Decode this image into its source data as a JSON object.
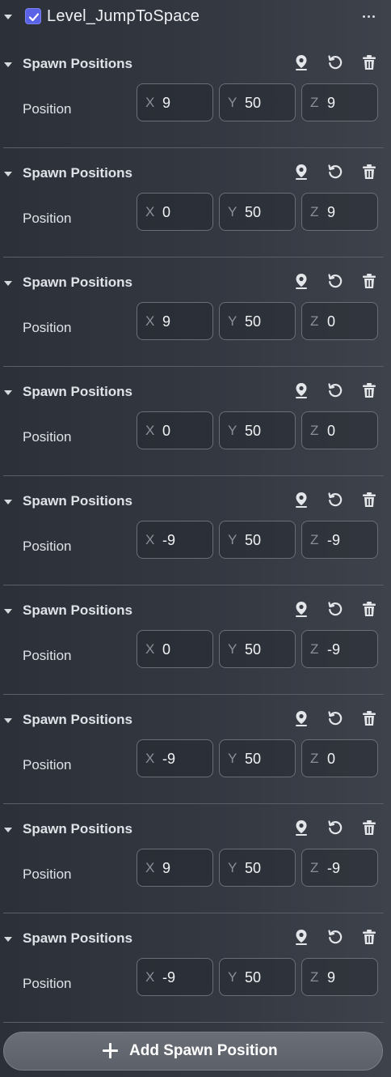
{
  "component": {
    "enabled": true,
    "title": "Level_JumpToSpace",
    "menu_icon": "more-horizontal-icon"
  },
  "spawn_positions": [
    {
      "title": "Spawn Positions",
      "label": "Position",
      "x": "9",
      "y": "50",
      "z": "9"
    },
    {
      "title": "Spawn Positions",
      "label": "Position",
      "x": "0",
      "y": "50",
      "z": "9"
    },
    {
      "title": "Spawn Positions",
      "label": "Position",
      "x": "9",
      "y": "50",
      "z": "0"
    },
    {
      "title": "Spawn Positions",
      "label": "Position",
      "x": "0",
      "y": "50",
      "z": "0"
    },
    {
      "title": "Spawn Positions",
      "label": "Position",
      "x": "-9",
      "y": "50",
      "z": "-9"
    },
    {
      "title": "Spawn Positions",
      "label": "Position",
      "x": "0",
      "y": "50",
      "z": "-9"
    },
    {
      "title": "Spawn Positions",
      "label": "Position",
      "x": "-9",
      "y": "50",
      "z": "0"
    },
    {
      "title": "Spawn Positions",
      "label": "Position",
      "x": "9",
      "y": "50",
      "z": "-9"
    },
    {
      "title": "Spawn Positions",
      "label": "Position",
      "x": "-9",
      "y": "50",
      "z": "9"
    }
  ],
  "axis_labels": {
    "x": "X",
    "y": "Y",
    "z": "Z"
  },
  "section_icons": [
    "location-pin-icon",
    "reset-icon",
    "trash-icon"
  ],
  "add_button": {
    "label": "Add Spawn Position",
    "icon": "plus-icon"
  },
  "colors": {
    "checkbox_accent": "#5a63e6"
  }
}
